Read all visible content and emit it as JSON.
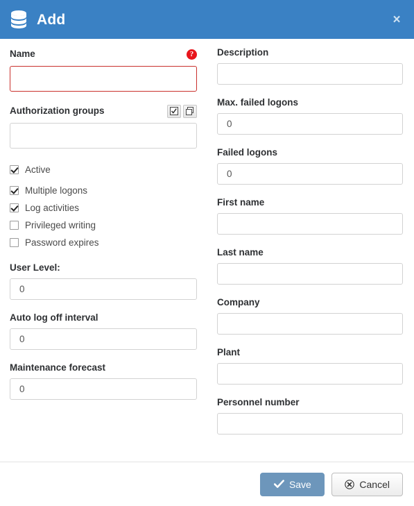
{
  "header": {
    "title": "Add",
    "icon": "database-icon",
    "close_label": "×",
    "background_color": "#3a81c4"
  },
  "form": {
    "left_column": {
      "name": {
        "label": "Name",
        "value": "",
        "placeholder": "",
        "required_badge": "?",
        "error_color": "#c9302c"
      },
      "authorization_groups": {
        "label": "Authorization groups",
        "value": "",
        "placeholder": "",
        "buttons": [
          {
            "name": "select-all-icon",
            "label": ""
          },
          {
            "name": "copy-icon",
            "label": ""
          }
        ]
      },
      "checkboxes": [
        {
          "label": "Active",
          "checked": true
        },
        {
          "label": "Multiple logons",
          "checked": true
        },
        {
          "label": "Log activities",
          "checked": true
        },
        {
          "label": "Privileged writing",
          "checked": false
        },
        {
          "label": "Password expires",
          "checked": false
        }
      ],
      "user_level": {
        "label": "User Level:",
        "value": "0"
      },
      "auto_log_off_interval": {
        "label": "Auto log off interval",
        "value": "0"
      },
      "maintenance_forecast": {
        "label": "Maintenance forecast",
        "value": "0"
      }
    },
    "right_column": {
      "description": {
        "label": "Description",
        "value": ""
      },
      "max_failed_logons": {
        "label": "Max. failed logons",
        "value": "0"
      },
      "failed_logons": {
        "label": "Failed logons",
        "value": "0"
      },
      "first_name": {
        "label": "First name",
        "value": ""
      },
      "last_name": {
        "label": "Last name",
        "value": ""
      },
      "company": {
        "label": "Company",
        "value": ""
      },
      "plant": {
        "label": "Plant",
        "value": ""
      },
      "personnel_number": {
        "label": "Personnel number",
        "value": ""
      }
    }
  },
  "footer": {
    "save_label": "Save",
    "cancel_label": "Cancel",
    "save_color": "#6d96bb"
  }
}
